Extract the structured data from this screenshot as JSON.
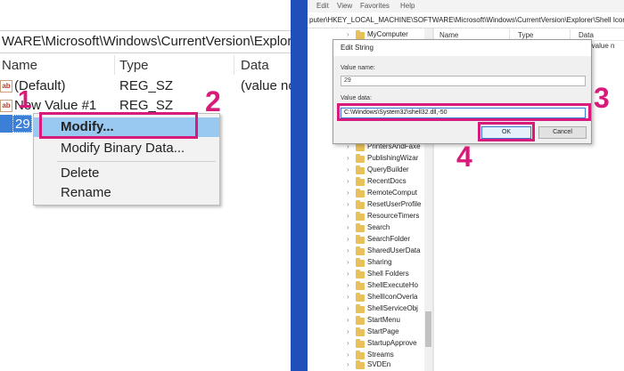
{
  "left_panel": {
    "address": "WARE\\Microsoft\\Windows\\CurrentVersion\\Explorer\\She",
    "columns": [
      "Name",
      "Type",
      "Data"
    ],
    "rows": [
      {
        "name": "(Default)",
        "type": "REG_SZ",
        "data": "(value no"
      },
      {
        "name": "New Value #1",
        "type": "REG_SZ",
        "data": ""
      }
    ],
    "selected_value": "29",
    "context_menu": {
      "items": [
        "Modify...",
        "Modify Binary Data...",
        "Delete",
        "Rename"
      ],
      "highlighted": "Modify..."
    }
  },
  "right_panel": {
    "menu": [
      "Edit",
      "View",
      "Favorites",
      "Help"
    ],
    "address": "puter\\HKEY_LOCAL_MACHINE\\SOFTWARE\\Microsoft\\Windows\\CurrentVersion\\Explorer\\Shell Icons",
    "columns": [
      "Name",
      "Type",
      "Data"
    ],
    "data_preview": "(value n",
    "tree": [
      "MyComputer",
      "PrintersAndFaxe",
      "PublishingWizar",
      "QueryBuilder",
      "RecentDocs",
      "RemoteComput",
      "ResetUserProfile",
      "ResourceTimers",
      "Search",
      "SearchFolder",
      "SharedUserData",
      "Sharing",
      "Shell Folders",
      "ShellExecuteHo",
      "ShellIconOverla",
      "ShellServiceObj",
      "StartMenu",
      "StartPage",
      "StartupApprove",
      "Streams",
      "SVDEn"
    ],
    "dialog": {
      "title": "Edit String",
      "value_name_label": "Value name:",
      "value_name": "29",
      "value_data_label": "Value data:",
      "value_data": "C:\\Windows\\System32\\shell32.dll,-50",
      "ok": "OK",
      "cancel": "Cancel"
    }
  },
  "steps": [
    "1",
    "2",
    "3",
    "4"
  ],
  "icons": {
    "string_value": "ab-icon",
    "folder": "folder-icon",
    "chevron": "chevron-right-icon"
  },
  "colors": {
    "highlight_pink": "#d81b7a",
    "selection_blue": "#3b7fd6",
    "menu_hover": "#99c8f0",
    "divider": "#1f4fb8"
  }
}
